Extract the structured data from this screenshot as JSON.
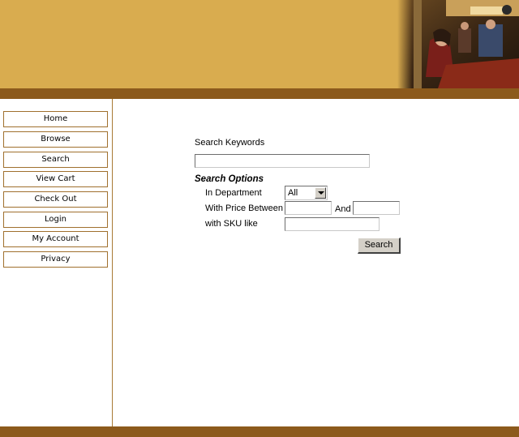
{
  "nav": {
    "items": [
      {
        "label": "Home"
      },
      {
        "label": "Browse"
      },
      {
        "label": "Search"
      },
      {
        "label": "View Cart"
      },
      {
        "label": "Check Out"
      },
      {
        "label": "Login"
      },
      {
        "label": "My Account"
      },
      {
        "label": "Privacy"
      }
    ]
  },
  "search": {
    "keywords_label": "Search Keywords",
    "keywords_value": "",
    "options_heading": "Search Options",
    "department_label": "In Department",
    "department_value": "All",
    "price_label": "With Price Between",
    "price_and_label": "And",
    "price_min_value": "",
    "price_max_value": "",
    "sku_label": "with SKU like",
    "sku_value": "",
    "button_label": "Search"
  },
  "colors": {
    "header": "#d9ac4f",
    "bar": "#8c5a1c",
    "nav_border": "#a0702e"
  }
}
